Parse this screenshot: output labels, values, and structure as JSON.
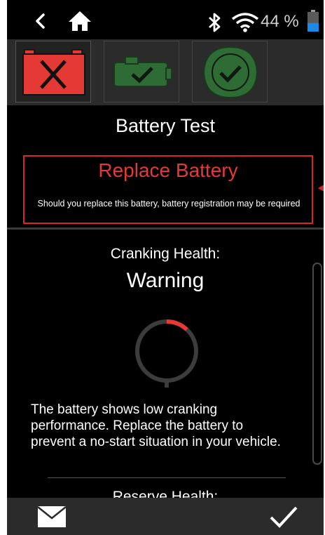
{
  "status_bar": {
    "back_icon": "chevron-left-icon",
    "home_icon": "home-icon",
    "bluetooth_icon": "bluetooth-icon",
    "wifi_icon": "wifi-icon",
    "battery_percent": "44 %",
    "battery_icon": "battery-icon",
    "battery_fill_fraction": 0.44
  },
  "tabs": [
    {
      "icon": "battery-fail-icon",
      "selected": true
    },
    {
      "icon": "battery-pass-icon",
      "selected": false
    },
    {
      "icon": "leaf-check-icon",
      "selected": false
    }
  ],
  "main": {
    "title": "Battery Test",
    "result_label": "Replace Battery",
    "result_note": "Should you replace this battery, battery registration may be required",
    "cranking_label": "Cranking Health:",
    "cranking_status": "Warning",
    "cranking_gauge_fraction": 0.12,
    "cranking_description": "The battery shows low cranking performance. Replace the battery to prevent a no-start situation in your vehicle.",
    "reserve_label": "Reserve Health:"
  },
  "bottom_bar": {
    "left_icon": "mail-icon",
    "right_icon": "checkmark-icon"
  },
  "colors": {
    "accent_red": "#e53935",
    "pass_green": "#2e6b35",
    "background": "#000000",
    "bar_gray": "#2b2b2b"
  }
}
